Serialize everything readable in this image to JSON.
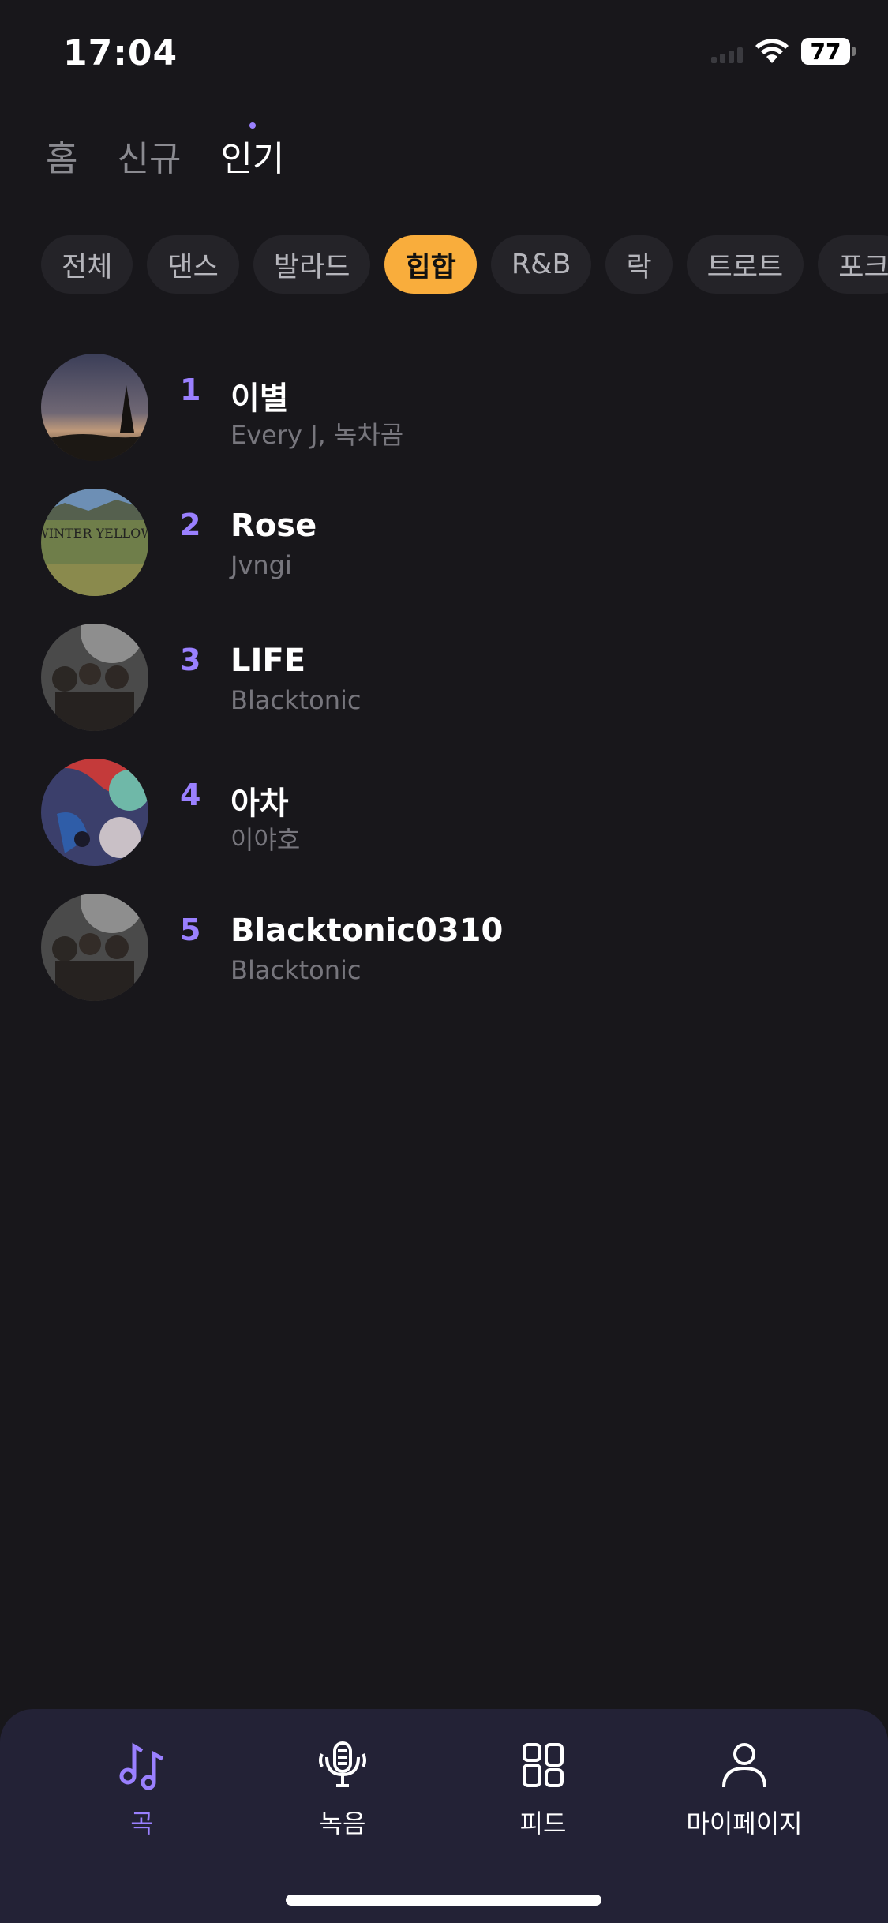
{
  "status": {
    "time": "17:04",
    "battery": "77"
  },
  "top_tabs": [
    {
      "label": "홈"
    },
    {
      "label": "신규"
    },
    {
      "label": "인기"
    }
  ],
  "genres": [
    {
      "label": "전체"
    },
    {
      "label": "댄스"
    },
    {
      "label": "발라드"
    },
    {
      "label": "힙합"
    },
    {
      "label": "R&B"
    },
    {
      "label": "락"
    },
    {
      "label": "트로트"
    },
    {
      "label": "포크"
    }
  ],
  "songs": [
    {
      "rank": "1",
      "title": "이별",
      "artist": "Every J, 녹차곰"
    },
    {
      "rank": "2",
      "title": "Rose",
      "artist": "Jvngi",
      "cover_text": "WINTER YELLOW"
    },
    {
      "rank": "3",
      "title": "LIFE",
      "artist": "Blacktonic"
    },
    {
      "rank": "4",
      "title": "아차",
      "artist": "이야호"
    },
    {
      "rank": "5",
      "title": "Blacktonic0310",
      "artist": "Blacktonic"
    }
  ],
  "bottom_nav": [
    {
      "label": "곡",
      "icon": "music-note-icon"
    },
    {
      "label": "녹음",
      "icon": "microphone-icon"
    },
    {
      "label": "피드",
      "icon": "grid-icon"
    },
    {
      "label": "마이페이지",
      "icon": "person-icon"
    }
  ],
  "colors": {
    "accent": "#9a80ff",
    "chip_active": "#f9ad3c",
    "background": "#18171b"
  }
}
